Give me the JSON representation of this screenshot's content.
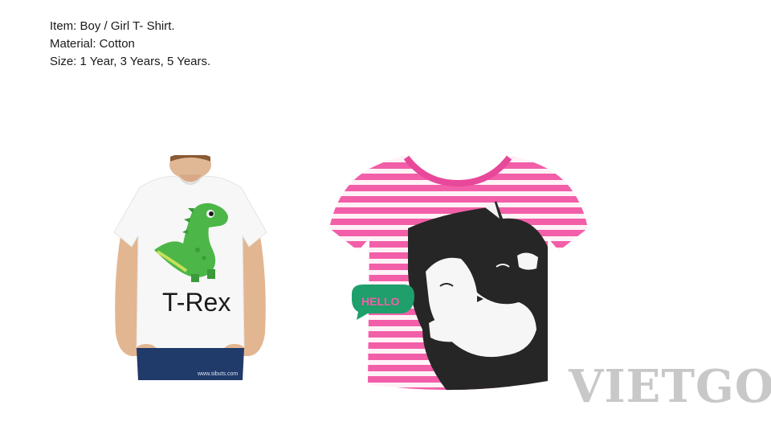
{
  "product": {
    "item": "Item: Boy / Girl T- Shirt.",
    "material": "Material: Cotton",
    "size": "Size: 1 Year, 3 Years, 5 Years."
  },
  "images": {
    "boy_shirt_print": "T-Rex",
    "boy_photo_credit": "www.sibuts.com",
    "girl_shirt_bubble": "HELLO"
  },
  "watermark": "VIETGO",
  "colors": {
    "stripe_pink": "#f25fa8",
    "collar_pink": "#e8489a",
    "dino_green": "#4cb648",
    "bubble_green": "#1e9f6b",
    "watermark_gray": "#c8c8c8"
  }
}
